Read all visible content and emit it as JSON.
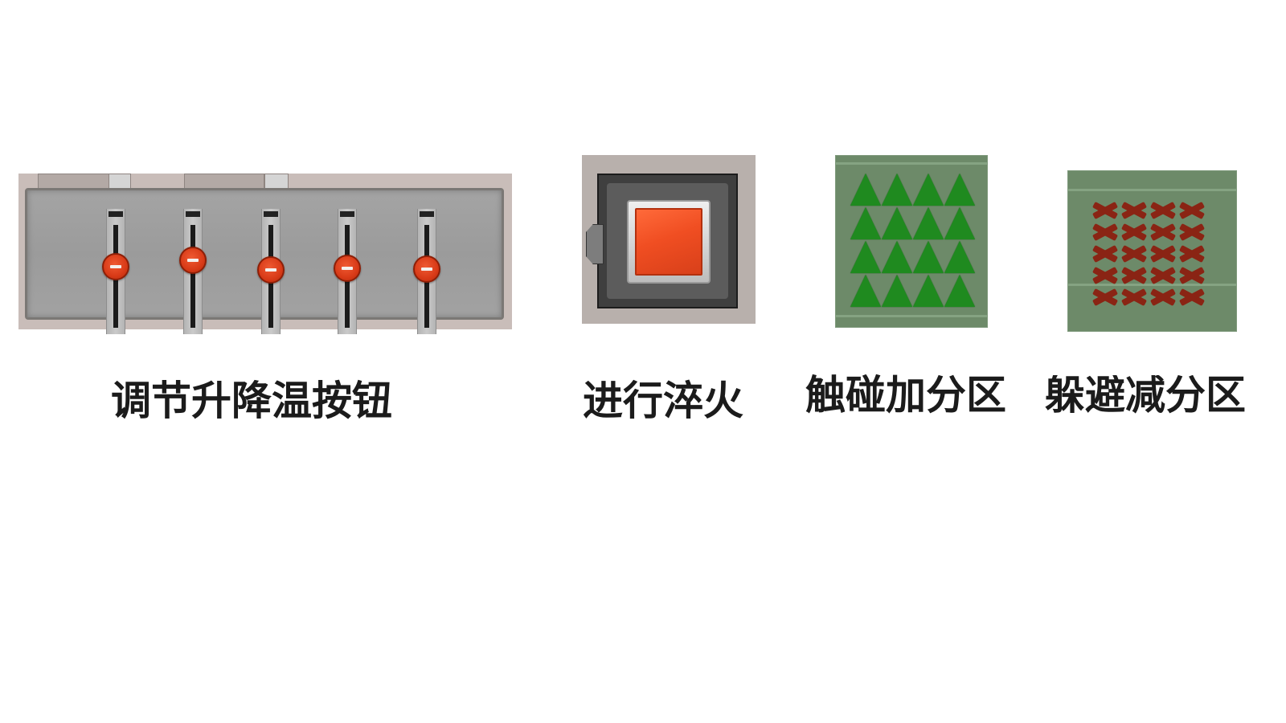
{
  "temperature_panel": {
    "caption": "调节升降温按钮",
    "sliders": [
      {
        "name": "slider-1",
        "level": 0.59
      },
      {
        "name": "slider-2",
        "level": 0.66
      },
      {
        "name": "slider-3",
        "level": 0.56
      },
      {
        "name": "slider-4",
        "level": 0.58
      },
      {
        "name": "slider-5",
        "level": 0.57
      }
    ],
    "knob_icon": "minus-icon",
    "knob_color": "#d83a17",
    "panel_color": "#9f9f9f"
  },
  "quench": {
    "caption": "进行淬火",
    "button_color": "#f04e22"
  },
  "bonus_zone": {
    "caption": "触碰加分区",
    "icon": "triangle-icon",
    "color": "#1f8a1f",
    "rows": 4,
    "cols": 4
  },
  "avoid_zone": {
    "caption": "躲避减分区",
    "icon": "x-mark-icon",
    "color": "#8a2414",
    "rows": 5,
    "cols": 4
  }
}
